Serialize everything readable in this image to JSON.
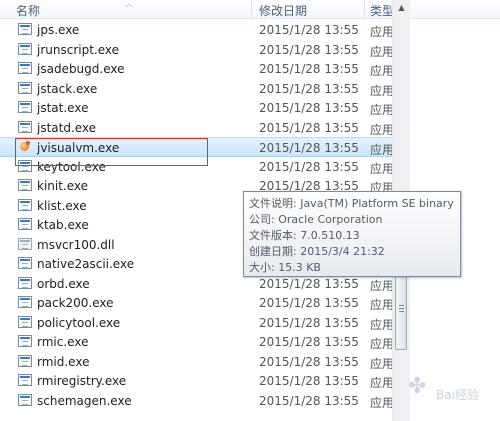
{
  "columns": {
    "name": "名称",
    "modified": "修改日期",
    "type": "类型"
  },
  "files": [
    {
      "name": "jps.exe",
      "date": "2015/1/28 13:55",
      "type": "应用",
      "icon": "exe-icon"
    },
    {
      "name": "jrunscript.exe",
      "date": "2015/1/28 13:55",
      "type": "应用",
      "icon": "exe-icon"
    },
    {
      "name": "jsadebugd.exe",
      "date": "2015/1/28 13:55",
      "type": "应用",
      "icon": "exe-icon"
    },
    {
      "name": "jstack.exe",
      "date": "2015/1/28 13:55",
      "type": "应用",
      "icon": "exe-icon"
    },
    {
      "name": "jstat.exe",
      "date": "2015/1/28 13:55",
      "type": "应用",
      "icon": "exe-icon"
    },
    {
      "name": "jstatd.exe",
      "date": "2015/1/28 13:55",
      "type": "应用",
      "icon": "exe-icon"
    },
    {
      "name": "jvisualvm.exe",
      "date": "2015/1/28 13:55",
      "type": "应用",
      "icon": "java-icon",
      "selected": true
    },
    {
      "name": "keytool.exe",
      "date": "2015/1/28 13:55",
      "type": "应用",
      "icon": "exe-icon"
    },
    {
      "name": "kinit.exe",
      "date": "2015/1/28 13:55",
      "type": "应用",
      "icon": "exe-icon"
    },
    {
      "name": "klist.exe",
      "date": "",
      "type": "",
      "icon": "exe-icon"
    },
    {
      "name": "ktab.exe",
      "date": "",
      "type": "",
      "icon": "exe-icon"
    },
    {
      "name": "msvcr100.dll",
      "date": "",
      "type": "",
      "icon": "dll-icon"
    },
    {
      "name": "native2ascii.exe",
      "date": "",
      "type": "",
      "icon": "exe-icon"
    },
    {
      "name": "orbd.exe",
      "date": "2015/1/28 13:55",
      "type": "应用",
      "icon": "exe-icon"
    },
    {
      "name": "pack200.exe",
      "date": "2015/1/28 13:55",
      "type": "应用",
      "icon": "exe-icon"
    },
    {
      "name": "policytool.exe",
      "date": "2015/1/28 13:55",
      "type": "应用",
      "icon": "exe-icon"
    },
    {
      "name": "rmic.exe",
      "date": "2015/1/28 13:55",
      "type": "应用",
      "icon": "exe-icon"
    },
    {
      "name": "rmid.exe",
      "date": "2015/1/28 13:55",
      "type": "应用",
      "icon": "exe-icon"
    },
    {
      "name": "rmiregistry.exe",
      "date": "2015/1/28 13:55",
      "type": "应用",
      "icon": "exe-icon"
    },
    {
      "name": "schemagen.exe",
      "date": "2015/1/28 13:55",
      "type": "应用",
      "icon": "exe-icon"
    }
  ],
  "tooltip": {
    "description": "文件说明: Java(TM) Platform SE binary",
    "company": "公司: Oracle Corporation",
    "version": "文件版本: 7.0.510.13",
    "created": "创建日期: 2015/3/4 21:32",
    "size": "大小: 15.3 KB"
  },
  "watermark": {
    "text": "Bai经验",
    "icon": "paw-icon"
  },
  "colors": {
    "selection": "#cde6fa",
    "highlight_box": "#d9352d",
    "header_text": "#4c607a"
  }
}
